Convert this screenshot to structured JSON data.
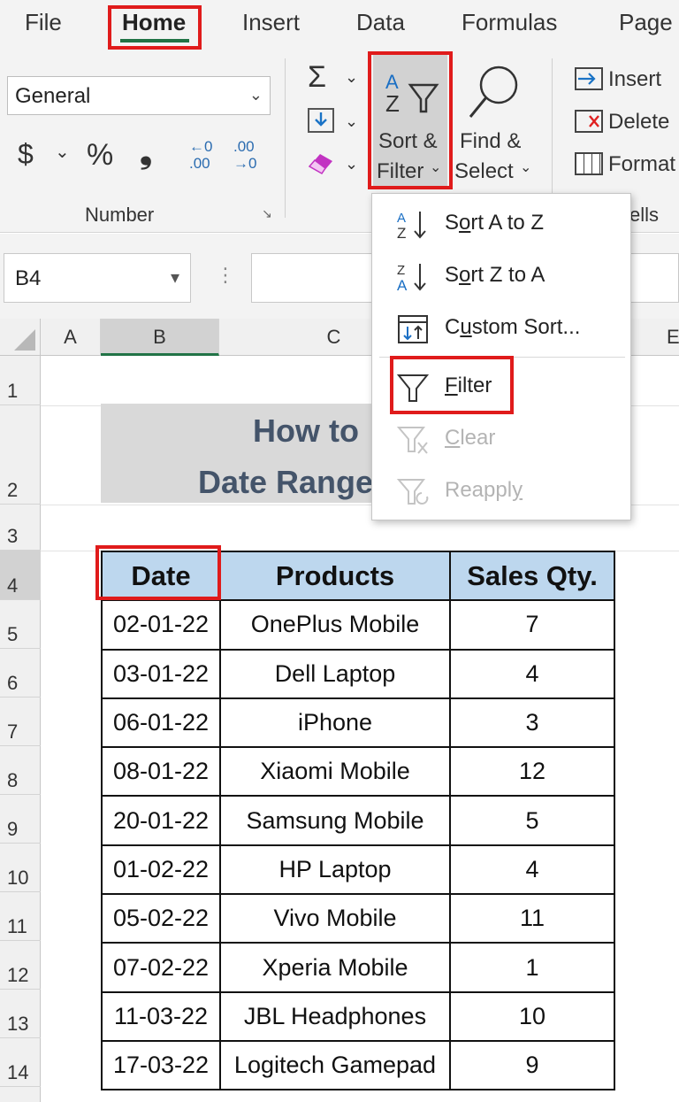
{
  "ribbon": {
    "tabs": [
      "File",
      "Home",
      "Insert",
      "Data",
      "Formulas",
      "Page"
    ],
    "active_tab": "Home",
    "number_format": "General",
    "number_group_label": "Number",
    "currency_symbol": "$",
    "percent_symbol": "%",
    "comma_symbol": "❟",
    "increase_decimal": "←0 .00",
    "decrease_decimal": ".00 →0",
    "sort_filter_label_1": "Sort &",
    "sort_filter_label_2": "Filter",
    "find_select_label_1": "Find &",
    "find_select_label_2": "Select",
    "insert_label": "Insert",
    "delete_label": "Delete",
    "format_label": "Format",
    "cells_group_label": "ells",
    "autosum_symbol": "Σ"
  },
  "formula_bar": {
    "name_box": "B4",
    "cancel_symbol": "✕",
    "enter_symbol": "✓"
  },
  "sort_menu": {
    "items": [
      {
        "label": "Sort A to Z",
        "underline": "o",
        "enabled": true
      },
      {
        "label": "Sort Z to A",
        "underline": "o",
        "enabled": true
      },
      {
        "label": "Custom Sort...",
        "underline": "u",
        "enabled": true
      },
      {
        "label": "Filter",
        "underline": "F",
        "enabled": true
      },
      {
        "label": "Clear",
        "underline": "C",
        "enabled": false
      },
      {
        "label": "Reapply",
        "underline": "y",
        "enabled": false
      }
    ]
  },
  "grid": {
    "columns": [
      "A",
      "B",
      "C",
      "E"
    ],
    "selected_column": "B",
    "rows": [
      "1",
      "2",
      "3",
      "4",
      "5",
      "6",
      "7",
      "8",
      "9",
      "10",
      "11",
      "12",
      "13",
      "14"
    ],
    "selected_row": "4",
    "title_line_1": "How to",
    "title_line_2": "Date Range"
  },
  "table": {
    "headers": [
      "Date",
      "Products",
      "Sales Qty."
    ],
    "rows": [
      [
        "02-01-22",
        "OnePlus Mobile",
        "7"
      ],
      [
        "03-01-22",
        "Dell Laptop",
        "4"
      ],
      [
        "06-01-22",
        "iPhone",
        "3"
      ],
      [
        "08-01-22",
        "Xiaomi Mobile",
        "12"
      ],
      [
        "20-01-22",
        "Samsung Mobile",
        "5"
      ],
      [
        "01-02-22",
        "HP Laptop",
        "4"
      ],
      [
        "05-02-22",
        "Vivo Mobile",
        "11"
      ],
      [
        "07-02-22",
        "Xperia Mobile",
        "1"
      ],
      [
        "11-03-22",
        "JBL Headphones",
        "10"
      ],
      [
        "17-03-22",
        "Logitech Gamepad",
        "9"
      ]
    ]
  },
  "colors": {
    "accent_green": "#217346",
    "highlight_red": "#e01b1b",
    "header_fill": "#bdd7ee",
    "title_fill": "#d9d9d9",
    "title_text": "#44546a"
  }
}
